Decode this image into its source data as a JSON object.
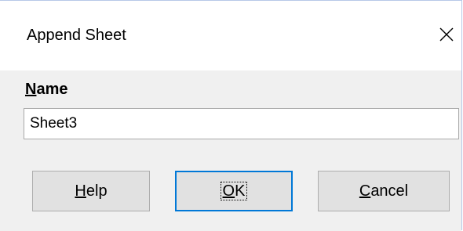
{
  "dialog": {
    "title": "Append Sheet",
    "name_label_mnemonic": "N",
    "name_label_rest": "ame",
    "name_value": "Sheet3"
  },
  "buttons": {
    "help_mnemonic": "H",
    "help_rest": "elp",
    "ok_mnemonic": "O",
    "ok_rest": "K",
    "cancel_mnemonic": "C",
    "cancel_rest": "ancel"
  },
  "icons": {
    "close": "close-icon"
  },
  "colors": {
    "title_bg": "#ffffff",
    "body_bg": "#f0f0f0",
    "button_bg": "#e1e1e1",
    "focus_border": "#0078d7"
  }
}
